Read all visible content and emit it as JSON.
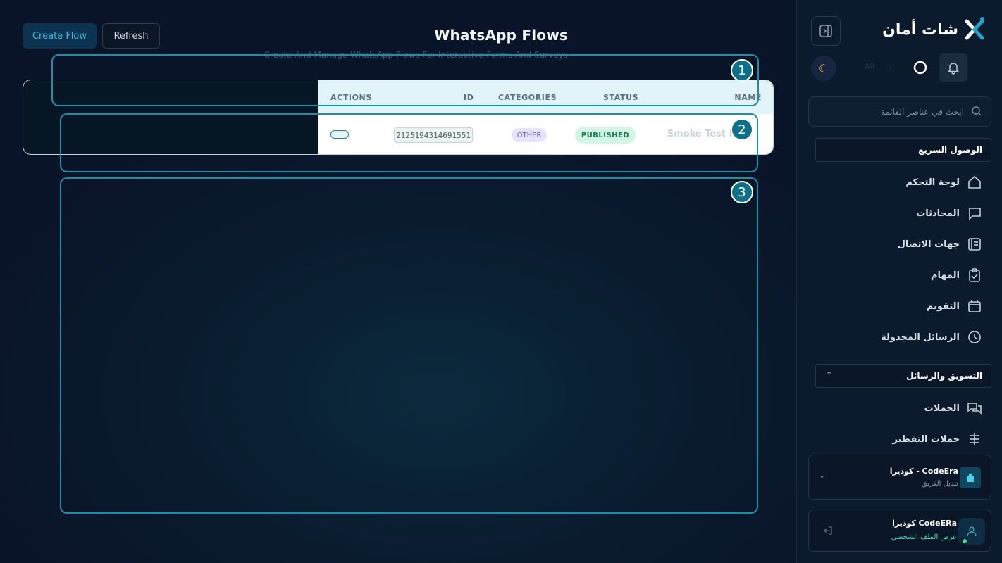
{
  "toolbar": {
    "create_label": "Create Flow",
    "refresh_label": "Refresh"
  },
  "page": {
    "title": "WhatsApp Flows",
    "subtitle": "Create And Manage WhatsApp Flows For Interactive Forms And Surveys"
  },
  "table": {
    "columns": {
      "actions": "ACTIONS",
      "id": "ID",
      "categories": "CATEGORIES",
      "status": "STATUS",
      "name": "NAME"
    },
    "rows": [
      {
        "id": "2125194314691551",
        "category": "OTHER",
        "status": "PUBLISHED",
        "name": "Smoke Test Flow"
      }
    ]
  },
  "highlights": [
    "1",
    "2",
    "3"
  ],
  "sidebar": {
    "brand": "شات أمان",
    "lang": "AR",
    "search_placeholder": "ابحث في عناصر القائمة",
    "quick_access_label": "الوصول السريع",
    "quick_items": [
      {
        "label": "لوحة التحكم",
        "icon": "home-icon"
      },
      {
        "label": "المحادثات",
        "icon": "chat-icon"
      },
      {
        "label": "جهات الاتصال",
        "icon": "contacts-icon"
      },
      {
        "label": "المهام",
        "icon": "clipboard-check-icon"
      },
      {
        "label": "التقويم",
        "icon": "calendar-icon"
      },
      {
        "label": "الرسائل المجدولة",
        "icon": "clock-icon"
      }
    ],
    "marketing_label": "التسويق والرسائل",
    "marketing_items": [
      {
        "label": "الحملات",
        "icon": "messages-icon"
      },
      {
        "label": "حملات التقطير",
        "icon": "drip-icon"
      }
    ],
    "team": {
      "name": "كوديرا - CodeEra",
      "sub": "تبديل الفريق"
    },
    "user": {
      "name": "كوديرا CodeERa",
      "sub": "عرض الملف الشخصي"
    }
  },
  "colors": {
    "accent": "#1a90a8",
    "published_bg": "#d2f5e6",
    "published_text": "#147a55",
    "online_dot": "#2ee6a0"
  }
}
